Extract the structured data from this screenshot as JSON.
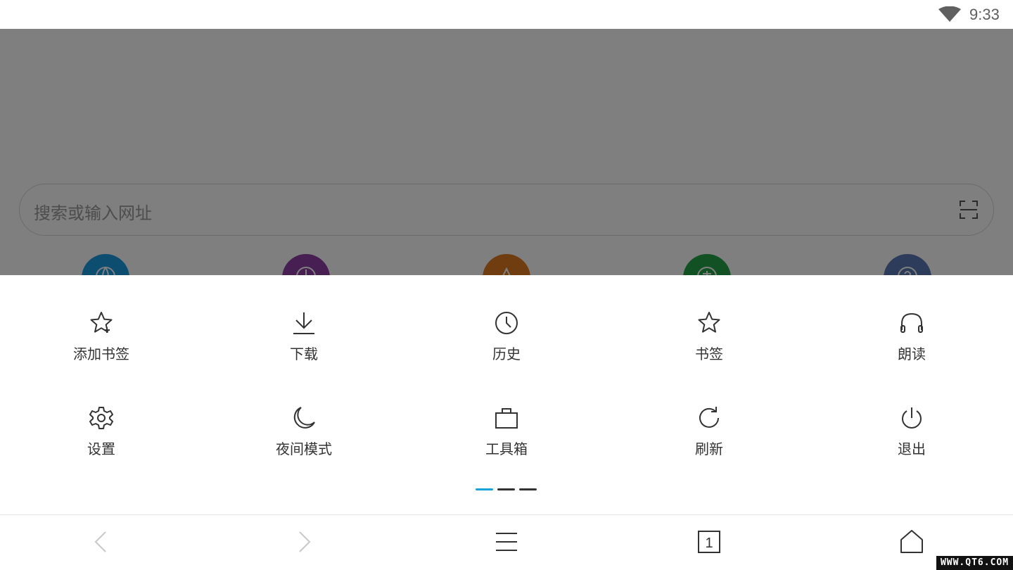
{
  "status_bar": {
    "time": "9:33",
    "wifi_icon": "wifi-icon"
  },
  "search": {
    "placeholder": "搜索或输入网址",
    "scan_icon": "scan-icon"
  },
  "quick_icons": [
    {
      "icon": "globe-icon",
      "color": "#1a9ae0"
    },
    {
      "icon": "compass-icon",
      "color": "#8e3fa6"
    },
    {
      "icon": "triangle-icon",
      "color": "#e07a22"
    },
    {
      "icon": "book-icon",
      "color": "#22a246"
    },
    {
      "icon": "question-icon",
      "color": "#5a78b6"
    }
  ],
  "menu": {
    "row1": [
      {
        "label": "添加书签",
        "icon": "star-plus-icon"
      },
      {
        "label": "下载",
        "icon": "download-icon"
      },
      {
        "label": "历史",
        "icon": "clock-icon"
      },
      {
        "label": "书签",
        "icon": "star-icon"
      },
      {
        "label": "朗读",
        "icon": "headphones-icon"
      }
    ],
    "row2": [
      {
        "label": "设置",
        "icon": "gear-icon"
      },
      {
        "label": "夜间模式",
        "icon": "moon-icon"
      },
      {
        "label": "工具箱",
        "icon": "toolbox-icon"
      },
      {
        "label": "刷新",
        "icon": "refresh-icon"
      },
      {
        "label": "退出",
        "icon": "power-icon"
      }
    ],
    "pager": {
      "pages": 3,
      "active": 1,
      "active_color": "#1aa3d6",
      "inactive_color": "#333333"
    }
  },
  "bottom_nav": {
    "back_icon": "chevron-left-icon",
    "forward_icon": "chevron-right-icon",
    "menu_icon": "hamburger-menu-icon",
    "tabs_count": "1",
    "home_icon": "home-icon"
  },
  "watermark": "WWW.QT6.COM"
}
